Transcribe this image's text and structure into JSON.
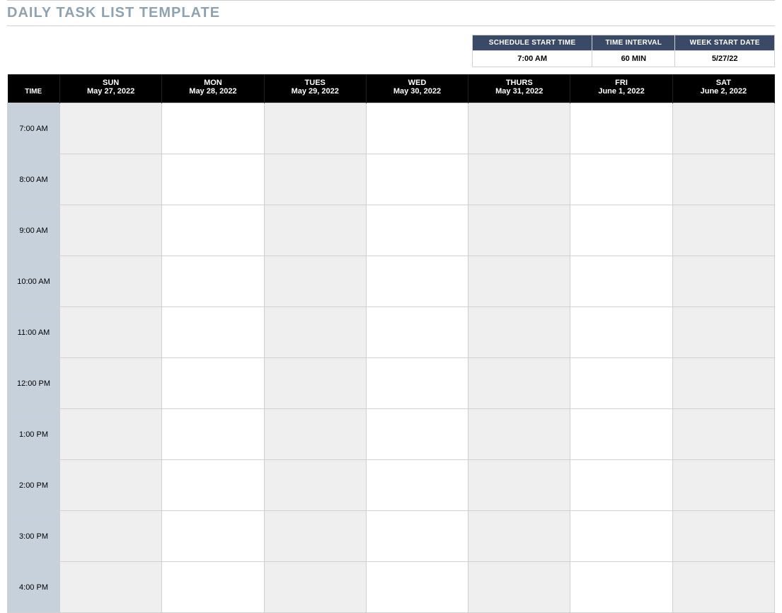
{
  "title": "DAILY TASK LIST TEMPLATE",
  "settings": {
    "headers": {
      "start_time": "SCHEDULE START TIME",
      "interval": "TIME INTERVAL",
      "week_start": "WEEK START DATE"
    },
    "values": {
      "start_time": "7:00 AM",
      "interval": "60 MIN",
      "week_start": "5/27/22"
    }
  },
  "schedule": {
    "time_header": "TIME",
    "days": [
      {
        "name": "SUN",
        "date": "May 27, 2022"
      },
      {
        "name": "MON",
        "date": "May 28, 2022"
      },
      {
        "name": "TUES",
        "date": "May 29, 2022"
      },
      {
        "name": "WED",
        "date": "May 30, 2022"
      },
      {
        "name": "THURS",
        "date": "May 31, 2022"
      },
      {
        "name": "FRI",
        "date": "June 1, 2022"
      },
      {
        "name": "SAT",
        "date": "June 2, 2022"
      }
    ],
    "times": [
      "7:00 AM",
      "8:00 AM",
      "9:00 AM",
      "10:00 AM",
      "11:00 AM",
      "12:00 PM",
      "1:00 PM",
      "2:00 PM",
      "3:00 PM",
      "4:00 PM"
    ],
    "shaded_day_indices": [
      0,
      2,
      4,
      6
    ]
  }
}
